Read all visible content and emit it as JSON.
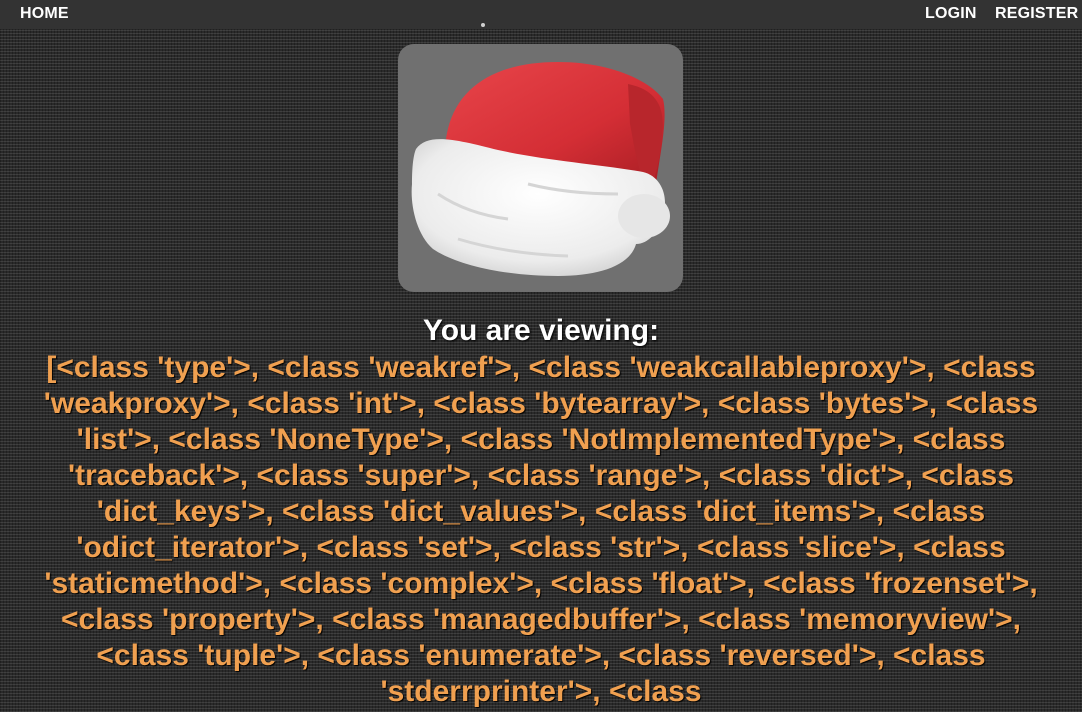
{
  "nav": {
    "home": "HOME",
    "login": "LOGIN",
    "register": "REGISTER"
  },
  "avatar": {
    "icon": "santa-hat-icon"
  },
  "content": {
    "viewing_label": "You are viewing:",
    "viewing_value": "[<class 'type'>, <class 'weakref'>, <class 'weakcallableproxy'>, <class 'weakproxy'>, <class 'int'>, <class 'bytearray'>, <class 'bytes'>, <class 'list'>, <class 'NoneType'>, <class 'NotImplementedType'>, <class 'traceback'>, <class 'super'>, <class 'range'>, <class 'dict'>, <class 'dict_keys'>, <class 'dict_values'>, <class 'dict_items'>, <class 'odict_iterator'>, <class 'set'>, <class 'str'>, <class 'slice'>, <class 'staticmethod'>, <class 'complex'>, <class 'float'>, <class 'frozenset'>, <class 'property'>, <class 'managedbuffer'>, <class 'memoryview'>, <class 'tuple'>, <class 'enumerate'>, <class 'reversed'>, <class 'stderrprinter'>, <class"
  },
  "colors": {
    "nav_bg": "#333333",
    "accent_text": "#f0a050",
    "hat_red": "#d9363b",
    "hat_fur": "#f2f2f2"
  }
}
